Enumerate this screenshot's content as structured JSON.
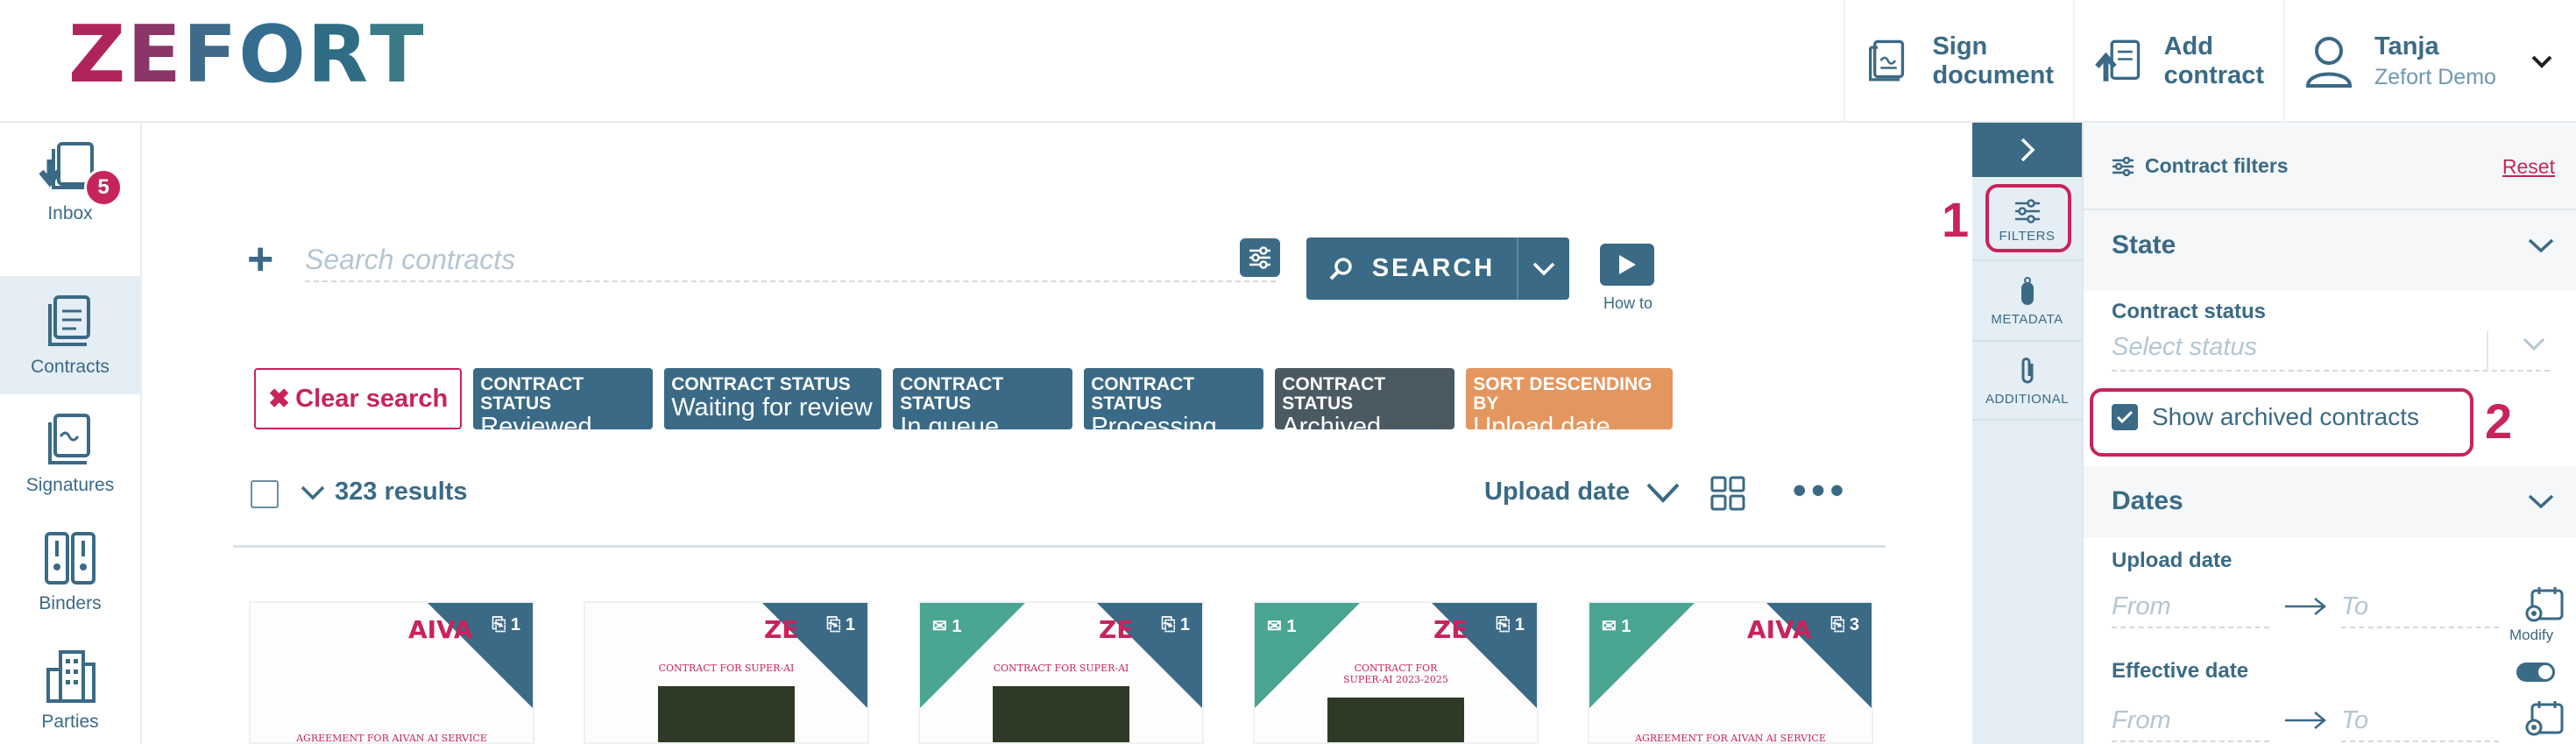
{
  "header": {
    "logo": [
      "Z",
      "E",
      "F",
      "O",
      "R",
      "T"
    ],
    "sign_document": "Sign\ndocument",
    "add_contract": "Add\ncontract",
    "user_name": "Tanja",
    "user_org": "Zefort Demo"
  },
  "sidebar": {
    "items": [
      {
        "label": "Inbox",
        "badge": "5"
      },
      {
        "label": "Contracts"
      },
      {
        "label": "Signatures"
      },
      {
        "label": "Binders"
      },
      {
        "label": "Parties"
      }
    ]
  },
  "search": {
    "placeholder": "Search contracts",
    "button_label": "SEARCH",
    "howto_label": "How to"
  },
  "chips": {
    "clear_label": "Clear search",
    "items": [
      {
        "key": "CONTRACT STATUS",
        "value": "Reviewed"
      },
      {
        "key": "CONTRACT STATUS",
        "value": "Waiting for review"
      },
      {
        "key": "CONTRACT STATUS",
        "value": "In queue"
      },
      {
        "key": "CONTRACT STATUS",
        "value": "Processing"
      },
      {
        "key": "CONTRACT STATUS",
        "value": "Archived"
      },
      {
        "key": "SORT DESCENDING BY",
        "value": "Upload date"
      }
    ]
  },
  "results": {
    "count": "323 results",
    "sort_label": "Upload date"
  },
  "cards": [
    {
      "attachments": "1",
      "brand": "AIVA",
      "title": "AGREEMENT FOR AIVAN AI SERVICE"
    },
    {
      "attachments": "1",
      "brand": "ZE",
      "title": "CONTRACT FOR SUPER-AI"
    },
    {
      "mail": "1",
      "attachments": "1",
      "brand": "ZE",
      "title": "CONTRACT FOR SUPER-AI"
    },
    {
      "mail": "1",
      "attachments": "1",
      "brand": "ZE",
      "title": "CONTRACT FOR SUPER-AI 2023-2025"
    },
    {
      "mail": "1",
      "attachments": "3",
      "brand": "AIVA",
      "title": "AGREEMENT FOR AIVAN AI SERVICE"
    }
  ],
  "filter_tabs": {
    "filters": "FILTERS",
    "metadata": "METADATA",
    "additional": "ADDITIONAL"
  },
  "annotations": {
    "one": "1",
    "two": "2"
  },
  "filter_panel": {
    "title": "Contract filters",
    "reset": "Reset",
    "state_section": "State",
    "contract_status_label": "Contract status",
    "status_placeholder": "Select status",
    "show_archived": "Show archived contracts",
    "dates_section": "Dates",
    "upload_date_label": "Upload date",
    "from": "From",
    "to": "To",
    "modify": "Modify",
    "effective_date_label": "Effective date"
  },
  "colors": {
    "primary": "#3a6a86",
    "accent": "#c7245b",
    "green": "#4aa593",
    "orange": "#e3975f",
    "dark_chip": "#4b5963"
  }
}
